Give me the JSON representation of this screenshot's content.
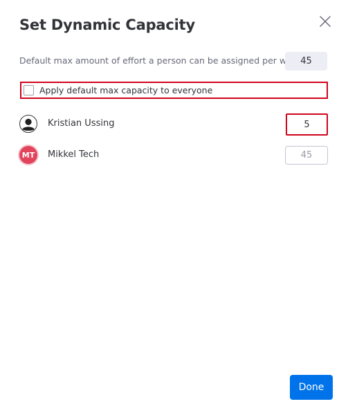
{
  "dialog": {
    "title": "Set Dynamic Capacity",
    "close_icon": "close-icon"
  },
  "default_capacity": {
    "label": "Default max amount of effort a person can be assigned per week",
    "value": "45"
  },
  "apply_default": {
    "label": "Apply default max capacity to everyone",
    "checked": false
  },
  "people": [
    {
      "name": "Kristian Ussing",
      "avatar_icon": "default-user-avatar-icon",
      "value": "5",
      "placeholder": ""
    },
    {
      "name": "Mikkel Tech",
      "initials": "MT",
      "avatar_color": "#e2445c",
      "value": "",
      "placeholder": "45"
    }
  ],
  "footer": {
    "done_label": "Done",
    "accent_color": "#0073ea"
  },
  "highlight_color": "#d0021b"
}
